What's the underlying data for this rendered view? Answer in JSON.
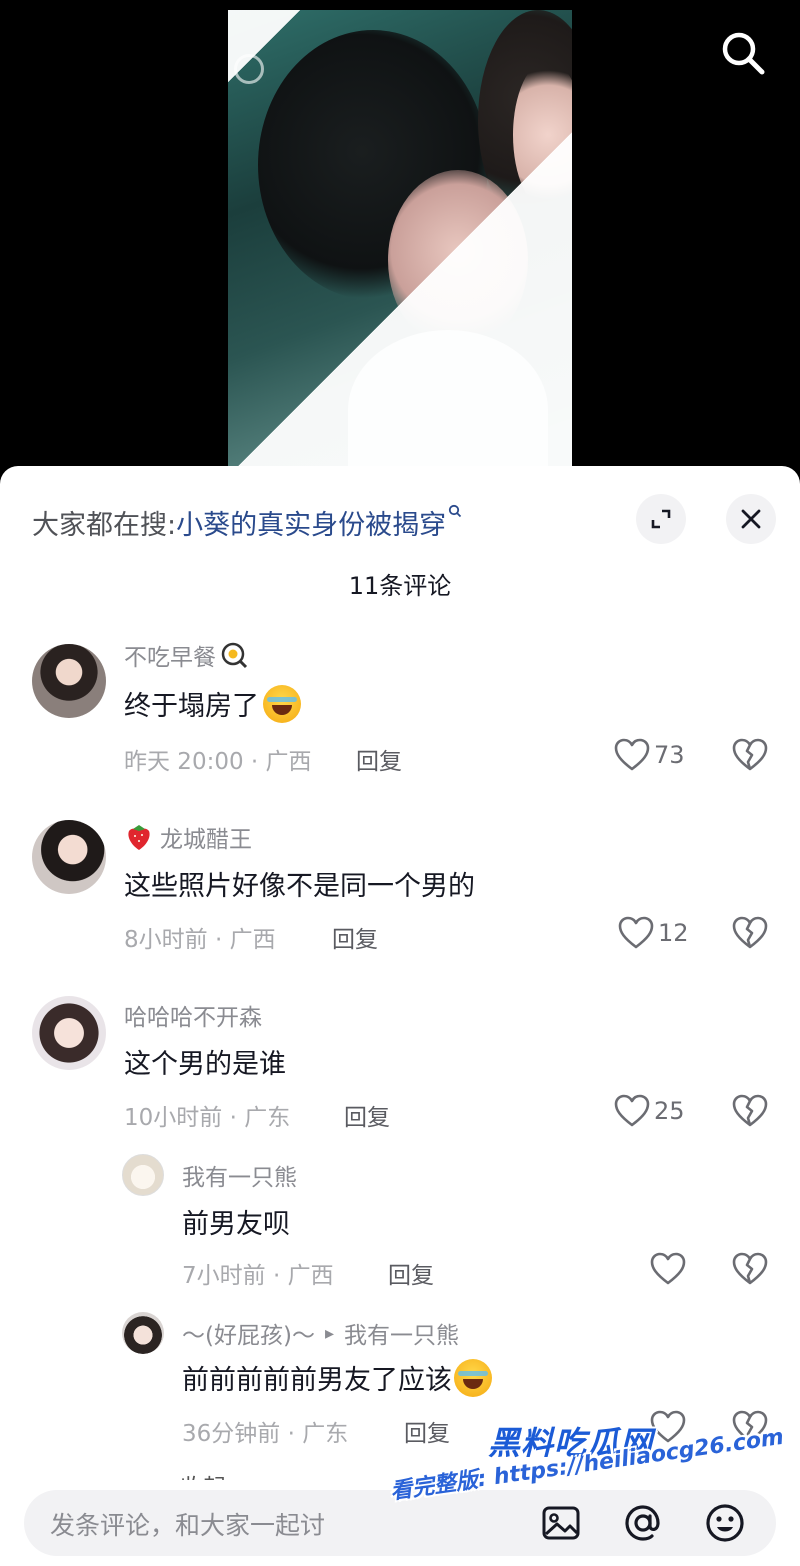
{
  "hot_search": {
    "prefix": "大家都在搜:",
    "query": "小葵的真实身份被揭穿"
  },
  "comment_count": "11条评论",
  "comments": [
    {
      "user": "不吃早餐",
      "text": "终于塌房了",
      "time_location": "昨天 20:00 · 广西",
      "reply": "回复",
      "likes": "73"
    },
    {
      "user": "龙城醋王",
      "text": "这些照片好像不是同一个男的",
      "time_location": "8小时前 · 广西",
      "reply": "回复",
      "likes": "12"
    },
    {
      "user": "哈哈哈不开森",
      "text": "这个男的是谁",
      "time_location": "10小时前 · 广东",
      "reply": "回复",
      "likes": "25"
    }
  ],
  "replies": [
    {
      "user": "我有一只熊",
      "text": "前男友呗",
      "time_location": "7小时前 · 广西",
      "reply": "回复"
    },
    {
      "user": "～(好屁孩)～",
      "reply_to_arrow": "▸",
      "reply_to": "我有一只熊",
      "text": "前前前前前男友了应该",
      "time_location": "36分钟前 · 广东",
      "reply": "回复"
    }
  ],
  "collapse_label": "收起",
  "input_placeholder": "发条评论，和大家一起讨",
  "watermark": {
    "title": "黑料吃瓜网",
    "url": "看完整版: https://heiliaocg26.com"
  },
  "icons": {
    "search": "search-icon",
    "expand": "expand-icon",
    "close": "close-icon",
    "like": "heart-icon",
    "dislike": "broken-heart-icon",
    "image": "image-icon",
    "mention": "at-icon",
    "emoji": "smile-icon"
  }
}
